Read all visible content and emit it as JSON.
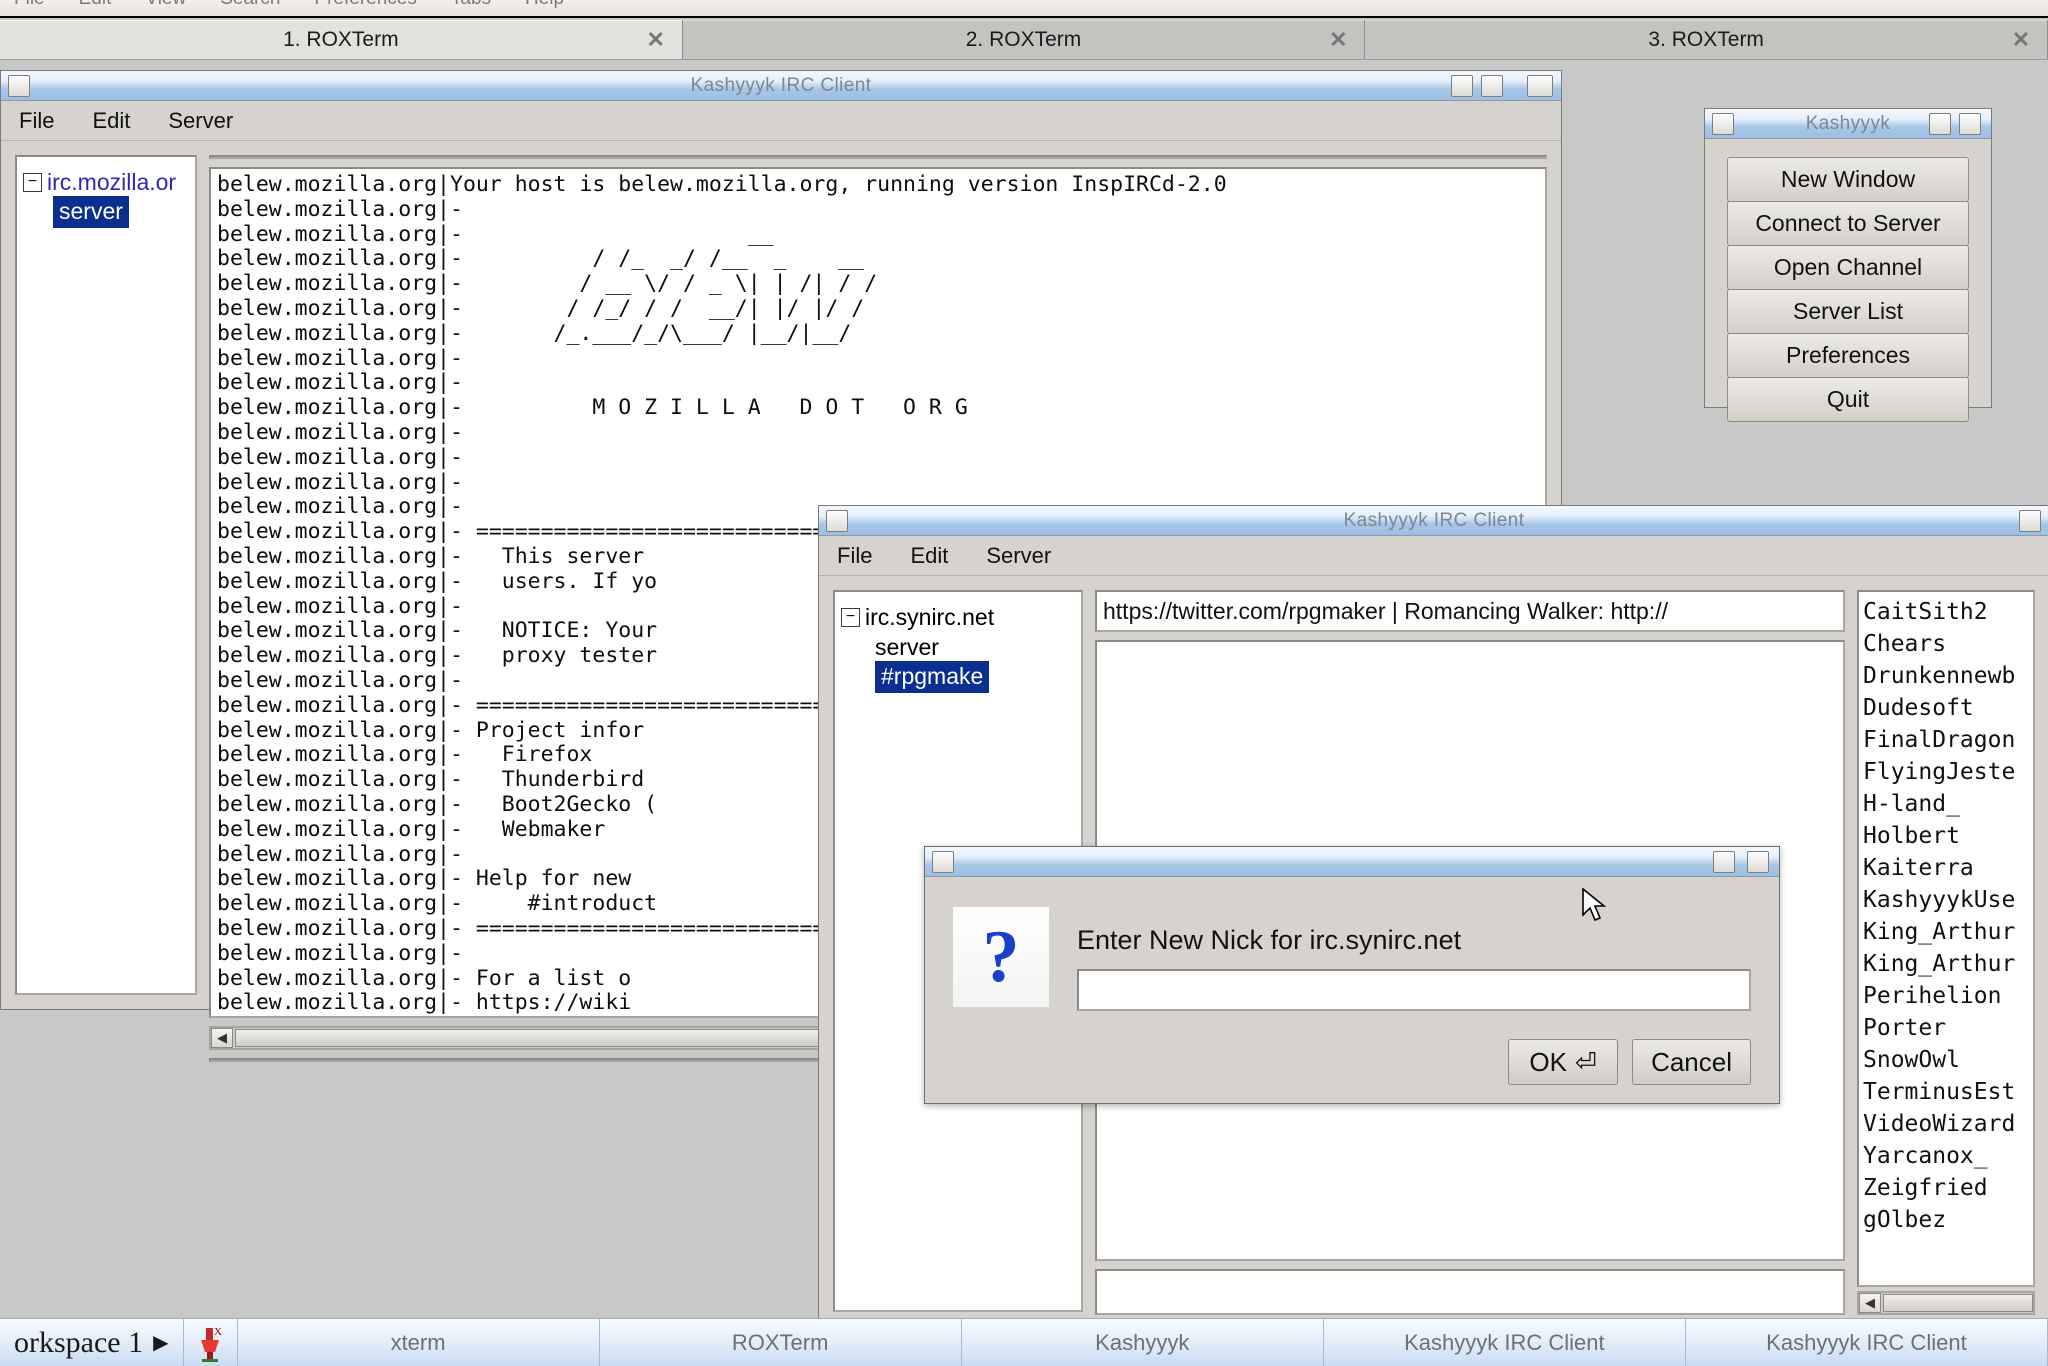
{
  "roxterm": {
    "menu": [
      "File",
      "Edit",
      "View",
      "Search",
      "Preferences",
      "Tabs",
      "Help"
    ],
    "tabs": [
      {
        "label": "1. ROXTerm",
        "close": "✕",
        "active": true
      },
      {
        "label": "2. ROXTerm",
        "close": "✕",
        "active": false
      },
      {
        "label": "3. ROXTerm",
        "close": "✕",
        "active": false
      }
    ]
  },
  "window_back": {
    "title": "Kashyyyk IRC Client",
    "menu": [
      "File",
      "Edit",
      "Server"
    ],
    "tree": {
      "expander": "−",
      "server_host": "irc.mozilla.or",
      "child_label": "server"
    },
    "topic": "",
    "input": "",
    "log": "belew.mozilla.org|Your host is belew.mozilla.org, running version InspIRCd-2.0\nbelew.mozilla.org|-\nbelew.mozilla.org|-                      __\nbelew.mozilla.org|-          / /_  _/ /__  _    __\nbelew.mozilla.org|-         / __ \\/ / _ \\| | /| / /\nbelew.mozilla.org|-        / /_/ / /  __/| |/ |/ /\nbelew.mozilla.org|-       /_.___/_/\\___/ |__/|__/\nbelew.mozilla.org|-\nbelew.mozilla.org|-\nbelew.mozilla.org|-          M O Z I L L A   D O T   O R G\nbelew.mozilla.org|-\nbelew.mozilla.org|-\nbelew.mozilla.org|-\nbelew.mozilla.org|-\nbelew.mozilla.org|- ===============================================\nbelew.mozilla.org|-   This server \nbelew.mozilla.org|-   users. If yo\nbelew.mozilla.org|-\nbelew.mozilla.org|-   NOTICE: Your\nbelew.mozilla.org|-   proxy tester\nbelew.mozilla.org|-\nbelew.mozilla.org|- ===============================================\nbelew.mozilla.org|- Project infor\nbelew.mozilla.org|-   Firefox    \nbelew.mozilla.org|-   Thunderbird\nbelew.mozilla.org|-   Boot2Gecko (\nbelew.mozilla.org|-   Webmaker   \nbelew.mozilla.org|-\nbelew.mozilla.org|- Help for new \nbelew.mozilla.org|-     #introduct\nbelew.mozilla.org|- ===============================================\nbelew.mozilla.org|-\nbelew.mozilla.org|- For a list o\nbelew.mozilla.org|- https://wiki",
    "scroll_left": "◀"
  },
  "window_palette": {
    "title": "Kashyyyk",
    "buttons": [
      "New Window",
      "Connect to Server",
      "Open Channel",
      "Server List",
      "Preferences",
      "Quit"
    ]
  },
  "window_front": {
    "title": "Kashyyyk IRC Client",
    "menu": [
      "File",
      "Edit",
      "Server"
    ],
    "tree": {
      "expander": "−",
      "server_host": "irc.synirc.net",
      "children": [
        "server",
        "#rpgmake"
      ]
    },
    "topic": "https://twitter.com/rpgmaker | Romancing Walker: http://",
    "input": "",
    "nicklist": [
      "CaitSith2",
      "Chears",
      "Drunkennewb",
      "Dudesoft",
      "FinalDragon",
      "FlyingJeste",
      "H-land_",
      "Holbert",
      "Kaiterra",
      "KashyyykUse",
      "King_Arthur",
      "King_Arthur",
      "Perihelion",
      "Porter",
      "SnowOwl",
      "TerminusEst",
      "VideoWizard",
      "Yarcanox_",
      "Zeigfried",
      "gOlbez"
    ],
    "scroll_left": "◀"
  },
  "dialog": {
    "icon": "?",
    "message": "Enter New Nick for irc.synirc.net",
    "input_value": "",
    "ok_label": "OK",
    "ok_glyph": "⏎",
    "cancel_label": "Cancel"
  },
  "taskbar": {
    "workspace": "orkspace 1",
    "workspace_arrow": "▶",
    "tasks": [
      "xterm",
      "ROXTerm",
      "Kashyyyk",
      "Kashyyyk IRC Client",
      "Kashyyyk IRC Client"
    ]
  },
  "colors": {
    "selection_blue": "#0b2f8f",
    "link_blue": "#2b2bb5",
    "title_gradient_top": "#f4f9ff",
    "title_gradient_bottom": "#9dbfe3",
    "question_blue": "#1b40c8",
    "face": "#d6d3ce"
  }
}
